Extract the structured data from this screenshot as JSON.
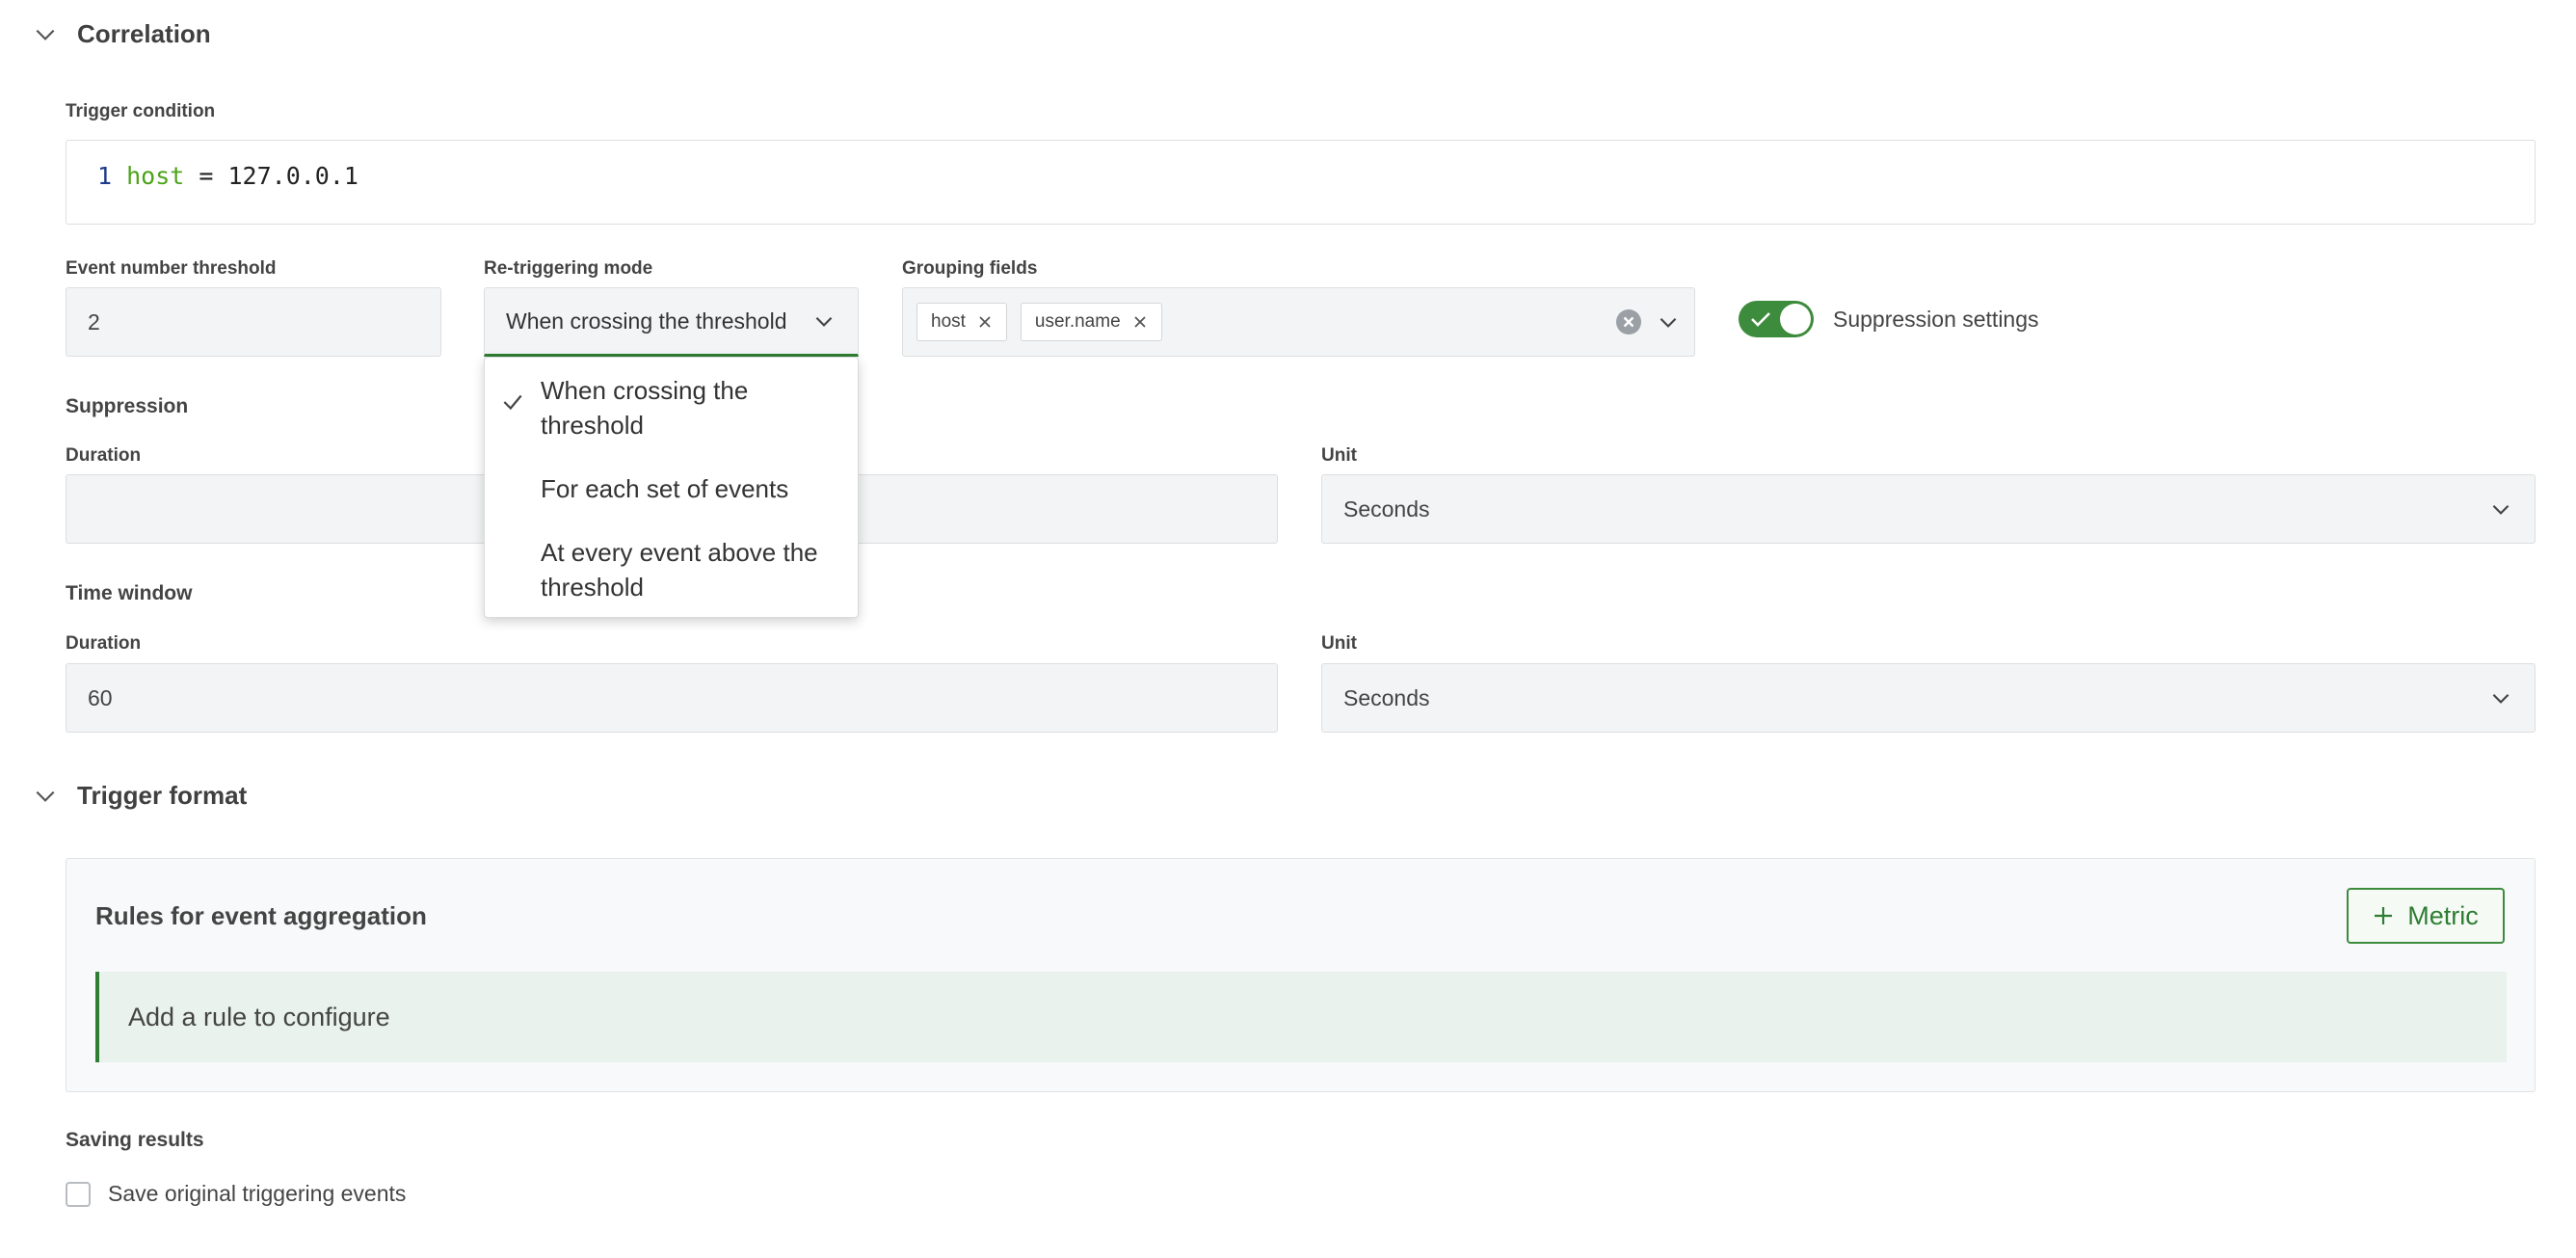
{
  "correlation": {
    "title": "Correlation",
    "trigger_condition": {
      "label": "Trigger condition",
      "line_number": "1",
      "keyword": "host",
      "operator": " = ",
      "value": "127.0.0.1"
    },
    "event_threshold": {
      "label": "Event number threshold",
      "value": "2"
    },
    "retrigger": {
      "label": "Re-triggering mode",
      "selected": "When crossing the threshold",
      "options": [
        {
          "line1": "When crossing the",
          "line2": "threshold",
          "checked": true
        },
        {
          "line1": "For each set of events",
          "line2": "",
          "checked": false
        },
        {
          "line1": "At every event above the",
          "line2": "threshold",
          "checked": false
        }
      ]
    },
    "grouping": {
      "label": "Grouping fields",
      "tags": [
        "host",
        "user.name"
      ]
    },
    "suppression_toggle": {
      "label": "Suppression settings",
      "on": true
    },
    "suppression": {
      "title": "Suppression",
      "duration_label": "Duration",
      "duration_value": "",
      "unit_label": "Unit",
      "unit_value": "Seconds"
    },
    "time_window": {
      "title": "Time window",
      "duration_label": "Duration",
      "duration_value": "60",
      "unit_label": "Unit",
      "unit_value": "Seconds"
    }
  },
  "trigger_format": {
    "title": "Trigger format",
    "panel_title": "Rules for event aggregation",
    "metric_button": "Metric",
    "empty_message": "Add a rule to configure"
  },
  "saving": {
    "title": "Saving results",
    "checkbox_label": "Save original triggering events",
    "checked": false
  },
  "colors": {
    "accent": "#2e7d32",
    "toggle": "#3d8b3d",
    "info_bg": "#e9f2ec"
  }
}
